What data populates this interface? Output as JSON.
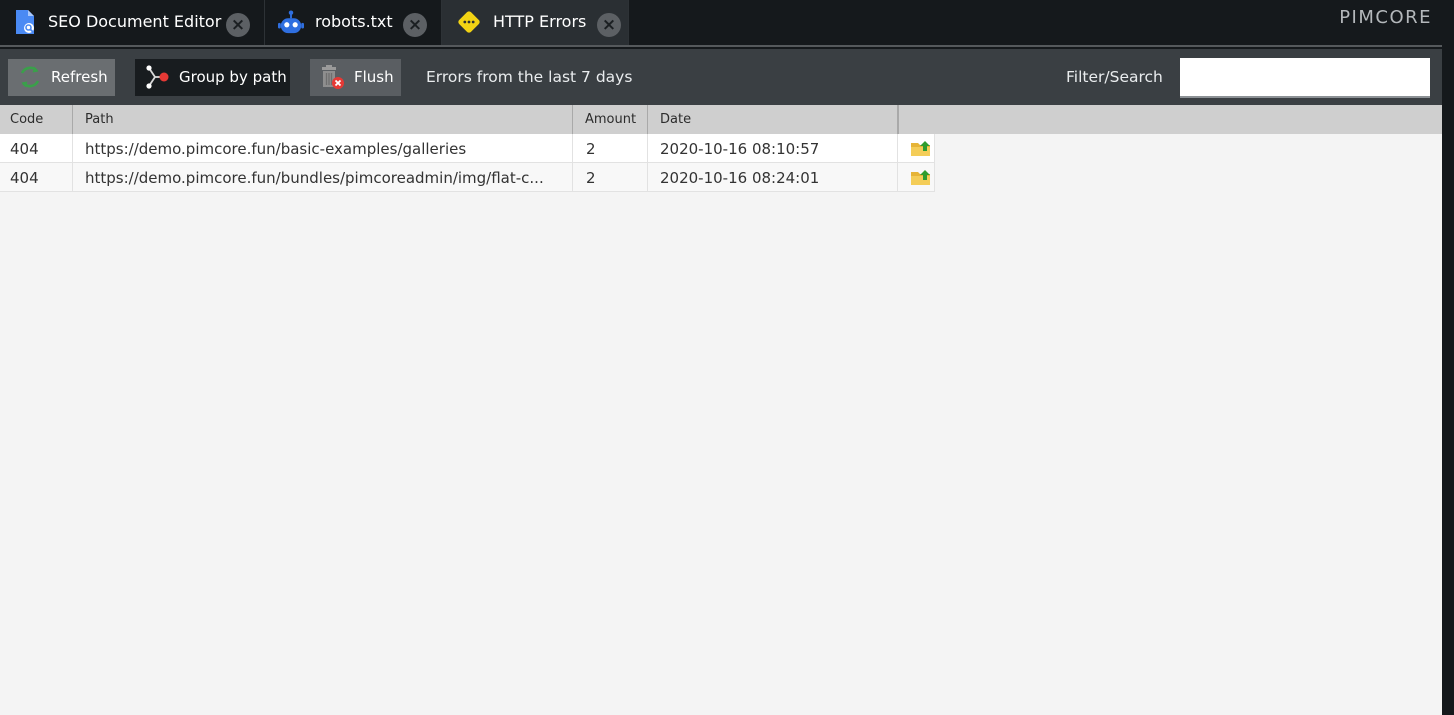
{
  "tabs": [
    {
      "label": "SEO Document Editor",
      "icon": "document-search-icon",
      "active": false
    },
    {
      "label": "robots.txt",
      "icon": "robot-icon",
      "active": false
    },
    {
      "label": "HTTP Errors",
      "icon": "warning-icon",
      "active": true
    }
  ],
  "brand": "PIMCORE",
  "toolbar": {
    "refresh_label": "Refresh",
    "group_label": "Group by path",
    "flush_label": "Flush",
    "info_text": "Errors from the last 7 days",
    "filter_label": "Filter/Search",
    "filter_value": ""
  },
  "grid": {
    "columns": [
      "Code",
      "Path",
      "Amount",
      "Date",
      ""
    ],
    "rows": [
      {
        "code": "404",
        "path": "https://demo.pimcore.fun/basic-examples/galleries",
        "amount": "2",
        "date": "2020-10-16 08:10:57"
      },
      {
        "code": "404",
        "path": "https://demo.pimcore.fun/bundles/pimcoreadmin/img/flat-c...",
        "amount": "2",
        "date": "2020-10-16 08:24:01"
      }
    ]
  },
  "colors": {
    "tabbar_bg": "#15191c",
    "toolbar_bg": "#3a3f43",
    "header_bg": "#cfcfcf",
    "accent_yellow": "#f2d314",
    "accent_blue": "#2f6fe0",
    "accent_green": "#3aa04a",
    "accent_red": "#e53935"
  }
}
